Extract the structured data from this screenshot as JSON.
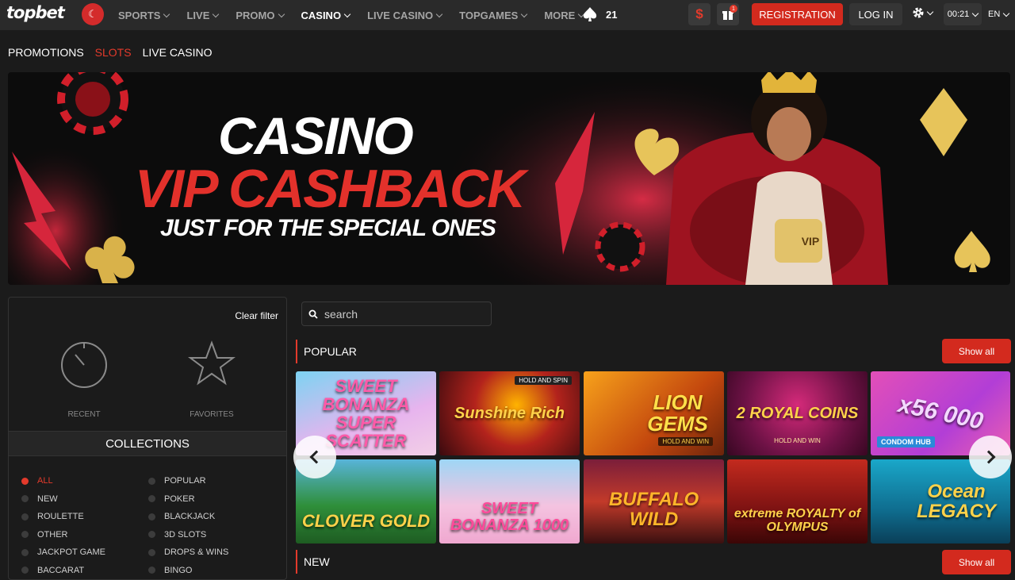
{
  "header": {
    "logo": "topbet",
    "flag": "☾",
    "nav": [
      {
        "label": "SPORTS",
        "active": false
      },
      {
        "label": "LIVE",
        "active": false
      },
      {
        "label": "PROMO",
        "active": false
      },
      {
        "label": "CASINO",
        "active": true
      },
      {
        "label": "LIVE CASINO",
        "active": false
      },
      {
        "label": "TOPGAMES",
        "active": false
      },
      {
        "label": "MORE",
        "active": false
      }
    ],
    "spade_count": "21",
    "dollar": "$",
    "gift_badge": "1",
    "registration": "REGISTRATION",
    "login": "LOG IN",
    "clock": "00:21",
    "lang": "EN"
  },
  "subnav": [
    {
      "label": "PROMOTIONS",
      "active": false
    },
    {
      "label": "SLOTS",
      "active": true
    },
    {
      "label": "LIVE CASINO",
      "active": false
    }
  ],
  "banner": {
    "line1": "CASINO",
    "line2": "VIP CASHBACK",
    "line3": "JUST FOR THE SPECIAL ONES",
    "dice_text": "VIP"
  },
  "filter": {
    "clear": "Clear filter",
    "recent": "RECENT",
    "favorites": "FAVORITES",
    "collections_title": "COLLECTIONS",
    "collections_left": [
      "ALL",
      "NEW",
      "ROULETTE",
      "OTHER",
      "JACKPOT GAME",
      "BACCARAT"
    ],
    "collections_right": [
      "POPULAR",
      "POKER",
      "BLACKJACK",
      "3D SLOTS",
      "DROPS & WINS",
      "BINGO"
    ]
  },
  "search": {
    "placeholder": "search"
  },
  "sections": {
    "popular": "POPULAR",
    "new": "NEW",
    "show_all": "Show all"
  },
  "games": [
    {
      "title": "SWEET BONANZA SUPER SCATTER"
    },
    {
      "title": "Sunshine Rich",
      "tag": "HOLD AND SPIN"
    },
    {
      "title": "LION GEMS",
      "tag": "HOLD AND WIN"
    },
    {
      "title": "2 ROYAL COINS",
      "tag": "HOLD AND WIN"
    },
    {
      "title": "x56 000",
      "tag": "CONDOM HUB"
    },
    {
      "title": "CLOVER GOLD"
    },
    {
      "title": "SWEET BONANZA 1000"
    },
    {
      "title": "BUFFALO WILD"
    },
    {
      "title": "extreme ROYALTY of OLYMPUS"
    },
    {
      "title": "Ocean LEGACY"
    }
  ],
  "colors": {
    "accent": "#e33a2b",
    "header_bg": "#2a2a2a",
    "page_bg": "#1b1b1b"
  }
}
